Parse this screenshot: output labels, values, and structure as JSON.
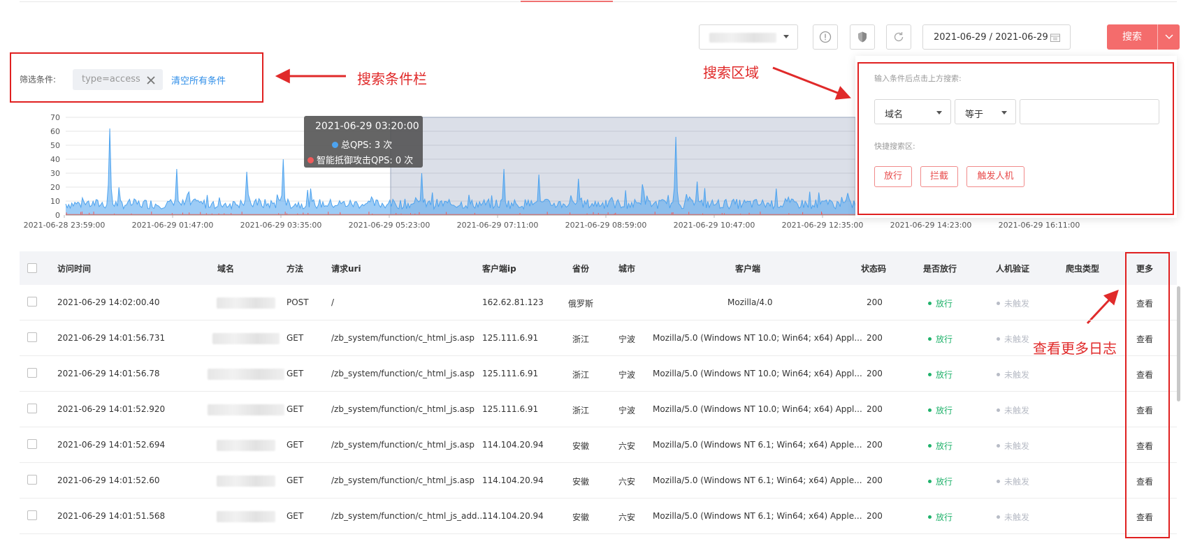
{
  "toolbar": {
    "date_range": "2021-06-29 / 2021-06-29",
    "search_label": "搜索"
  },
  "filter_bar": {
    "label": "筛选条件:",
    "tag": "type=access",
    "clear_all": "清空所有条件"
  },
  "annotations": {
    "filter_bar": "搜索条件栏",
    "search_area": "搜索区域",
    "more_logs": "查看更多日志"
  },
  "search_panel": {
    "hint": "输入条件后点击上方搜索:",
    "field_select": "域名",
    "operator_select": "等于",
    "value_input": "",
    "quick_label": "快捷搜索区:",
    "quick_buttons": [
      "放行",
      "拦截",
      "触发人机"
    ]
  },
  "chart_data": {
    "type": "area",
    "title": "",
    "ylim": [
      0,
      70
    ],
    "yticks": [
      "70",
      "60",
      "50",
      "40",
      "30",
      "20",
      "10",
      "0"
    ],
    "xticks": [
      "2021-06-28 23:59:00",
      "2021-06-29 01:47:00",
      "2021-06-29 03:35:00",
      "2021-06-29 05:23:00",
      "2021-06-29 07:11:00",
      "2021-06-29 08:59:00",
      "2021-06-29 10:47:00",
      "2021-06-29 12:35:00",
      "2021-06-29 14:23:00",
      "2021-06-29 16:11:00"
    ],
    "series": [
      {
        "name": "总QPS",
        "color": "#4da3ef",
        "baseline": 8,
        "peaks": [
          [
            0.055,
            62
          ],
          [
            0.14,
            33
          ],
          [
            0.23,
            31
          ],
          [
            0.275,
            40
          ],
          [
            0.45,
            30
          ],
          [
            0.555,
            33
          ],
          [
            0.6,
            29
          ],
          [
            0.65,
            26
          ],
          [
            0.73,
            22
          ],
          [
            0.773,
            56
          ],
          [
            0.8,
            24
          ],
          [
            0.9,
            19
          ]
        ]
      },
      {
        "name": "智能抵御攻击QPS",
        "color": "#f05a5a",
        "baseline": 0
      }
    ],
    "selection_range": [
      "2021-06-29 05:23:00",
      "2021-06-29 12:35:00"
    ],
    "tooltip": {
      "time": "2021-06-29 03:20:00",
      "line1": "总QPS: 3 次",
      "line2": "智能抵御攻击QPS: 0 次"
    }
  },
  "table": {
    "headers": [
      "访问时间",
      "域名",
      "方法",
      "请求uri",
      "客户端ip",
      "省份",
      "城市",
      "客户端",
      "状态码",
      "是否放行",
      "人机验证",
      "爬虫类型",
      "更多"
    ],
    "rows": [
      {
        "time": "2021-06-29 14:02:00.40",
        "method": "POST",
        "uri": "/",
        "ip": "162.62.81.123",
        "province": "俄罗斯",
        "city": "",
        "client": "Mozilla/4.0",
        "status": "200",
        "pass": "放行",
        "captcha": "未触发",
        "crawler": "",
        "more": "查看"
      },
      {
        "time": "2021-06-29 14:01:56.731",
        "method": "GET",
        "uri": "/zb_system/function/c_html_js.asp",
        "ip": "125.111.6.91",
        "province": "浙江",
        "city": "宁波",
        "client": "Mozilla/5.0 (Windows NT 10.0; Win64; x64) Appl...",
        "status": "200",
        "pass": "放行",
        "captcha": "未触发",
        "crawler": "",
        "more": "查看"
      },
      {
        "time": "2021-06-29 14:01:56.78",
        "method": "GET",
        "uri": "/zb_system/function/c_html_js.asp",
        "ip": "125.111.6.91",
        "province": "浙江",
        "city": "宁波",
        "client": "Mozilla/5.0 (Windows NT 10.0; Win64; x64) Appl...",
        "status": "200",
        "pass": "放行",
        "captcha": "未触发",
        "crawler": "",
        "more": "查看"
      },
      {
        "time": "2021-06-29 14:01:52.920",
        "method": "GET",
        "uri": "/zb_system/function/c_html_js.asp",
        "ip": "125.111.6.91",
        "province": "浙江",
        "city": "宁波",
        "client": "Mozilla/5.0 (Windows NT 10.0; Win64; x64) Appl...",
        "status": "200",
        "pass": "放行",
        "captcha": "未触发",
        "crawler": "",
        "more": "查看"
      },
      {
        "time": "2021-06-29 14:01:52.694",
        "method": "GET",
        "uri": "/zb_system/function/c_html_js.asp",
        "ip": "114.104.20.94",
        "province": "安徽",
        "city": "六安",
        "client": "Mozilla/5.0 (Windows NT 6.1; Win64; x64) Apple...",
        "status": "200",
        "pass": "放行",
        "captcha": "未触发",
        "crawler": "",
        "more": "查看"
      },
      {
        "time": "2021-06-29 14:01:52.60",
        "method": "GET",
        "uri": "/zb_system/function/c_html_js.asp",
        "ip": "114.104.20.94",
        "province": "安徽",
        "city": "六安",
        "client": "Mozilla/5.0 (Windows NT 6.1; Win64; x64) Apple...",
        "status": "200",
        "pass": "放行",
        "captcha": "未触发",
        "crawler": "",
        "more": "查看"
      },
      {
        "time": "2021-06-29 14:01:51.568",
        "method": "GET",
        "uri": "/zb_system/function/c_html_js_add....",
        "ip": "114.104.20.94",
        "province": "安徽",
        "city": "六安",
        "client": "Mozilla/5.0 (Windows NT 6.1; Win64; x64) Apple...",
        "status": "200",
        "pass": "放行",
        "captcha": "未触发",
        "crawler": "",
        "more": "查看"
      }
    ]
  }
}
